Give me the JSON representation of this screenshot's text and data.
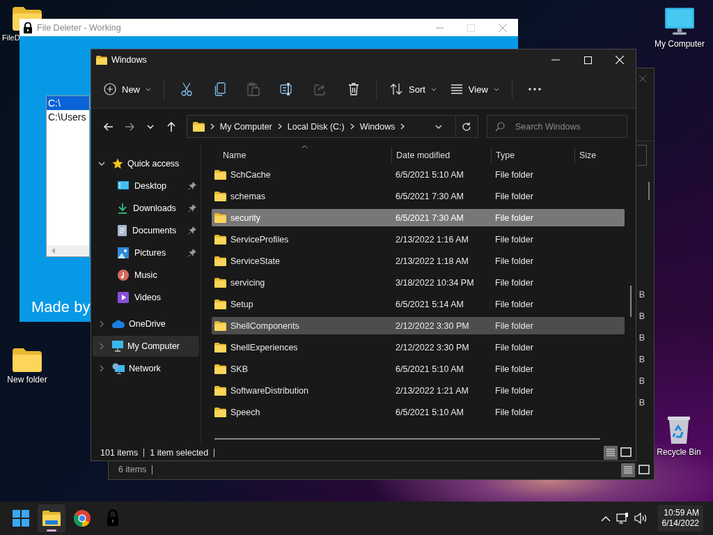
{
  "desktop_icons": [
    {
      "label": "FileD",
      "kind": "folder"
    },
    {
      "label": "New folder",
      "kind": "folder"
    },
    {
      "label": "My Computer",
      "kind": "computer"
    },
    {
      "label": "Recycle Bin",
      "kind": "recycle"
    }
  ],
  "file_deleter": {
    "title": "File Deleter - Working",
    "paths": [
      {
        "text": "C:\\",
        "selected": true
      },
      {
        "text": "C:\\Users",
        "selected": false
      }
    ],
    "footer": "Made by"
  },
  "back_explorer": {
    "sizes": [
      "B",
      "B",
      "B",
      "B",
      "B",
      "B"
    ],
    "status_bar": {
      "item_count": "6 items"
    }
  },
  "explorer": {
    "title": "Windows",
    "toolbar": [
      {
        "kind": "new",
        "label": "New",
        "disabled": false
      },
      {
        "kind": "cut",
        "disabled": false
      },
      {
        "kind": "copy",
        "disabled": false
      },
      {
        "kind": "paste",
        "disabled": true
      },
      {
        "kind": "rename",
        "disabled": false
      },
      {
        "kind": "share",
        "disabled": true
      },
      {
        "kind": "delete",
        "disabled": false
      },
      {
        "kind": "sort",
        "label": "Sort",
        "disabled": false
      },
      {
        "kind": "view",
        "label": "View",
        "disabled": false
      },
      {
        "kind": "more",
        "disabled": false
      }
    ],
    "nav": [
      {
        "kind": "back",
        "disabled": false
      },
      {
        "kind": "forward",
        "disabled": true
      },
      {
        "kind": "recent",
        "disabled": false
      },
      {
        "kind": "up",
        "disabled": false
      }
    ],
    "breadcrumb": [
      "My Computer",
      "Local Disk (C:)",
      "Windows"
    ],
    "search": {
      "placeholder": "Search Windows"
    },
    "sidebar": [
      {
        "label": "Quick access",
        "kind": "star",
        "expanded": true,
        "selected": false,
        "children": [
          {
            "label": "Desktop",
            "kind": "desktop",
            "pinned": true
          },
          {
            "label": "Downloads",
            "kind": "downloads",
            "pinned": true
          },
          {
            "label": "Documents",
            "kind": "documents",
            "pinned": true
          },
          {
            "label": "Pictures",
            "kind": "pictures",
            "pinned": true
          },
          {
            "label": "Music",
            "kind": "music",
            "pinned": false
          },
          {
            "label": "Videos",
            "kind": "videos",
            "pinned": false
          }
        ]
      },
      {
        "label": "OneDrive",
        "kind": "cloud",
        "expanded": false,
        "selected": false
      },
      {
        "label": "My Computer",
        "kind": "computer",
        "expanded": false,
        "selected": true
      },
      {
        "label": "Network",
        "kind": "network",
        "expanded": false,
        "selected": false
      }
    ],
    "columns": [
      {
        "label": "Name",
        "sorted": true
      },
      {
        "label": "Date modified",
        "sorted": false
      },
      {
        "label": "Type",
        "sorted": false
      },
      {
        "label": "Size",
        "sorted": false
      }
    ],
    "rows": [
      {
        "name": "SchCache",
        "date": "6/5/2021 5:10 AM",
        "type": "File folder",
        "selected": false,
        "hovered": false
      },
      {
        "name": "schemas",
        "date": "6/5/2021 7:30 AM",
        "type": "File folder",
        "selected": false,
        "hovered": false
      },
      {
        "name": "security",
        "date": "6/5/2021 7:30 AM",
        "type": "File folder",
        "selected": true,
        "hovered": false
      },
      {
        "name": "ServiceProfiles",
        "date": "2/13/2022 1:16 AM",
        "type": "File folder",
        "selected": false,
        "hovered": false
      },
      {
        "name": "ServiceState",
        "date": "2/13/2022 1:18 AM",
        "type": "File folder",
        "selected": false,
        "hovered": false
      },
      {
        "name": "servicing",
        "date": "3/18/2022 10:34 PM",
        "type": "File folder",
        "selected": false,
        "hovered": false
      },
      {
        "name": "Setup",
        "date": "6/5/2021 5:14 AM",
        "type": "File folder",
        "selected": false,
        "hovered": false
      },
      {
        "name": "ShellComponents",
        "date": "2/12/2022 3:30 PM",
        "type": "File folder",
        "selected": false,
        "hovered": true
      },
      {
        "name": "ShellExperiences",
        "date": "2/12/2022 3:30 PM",
        "type": "File folder",
        "selected": false,
        "hovered": false
      },
      {
        "name": "SKB",
        "date": "6/5/2021 5:10 AM",
        "type": "File folder",
        "selected": false,
        "hovered": false
      },
      {
        "name": "SoftwareDistribution",
        "date": "2/13/2022 1:21 AM",
        "type": "File folder",
        "selected": false,
        "hovered": false
      },
      {
        "name": "Speech",
        "date": "6/5/2021 5:10 AM",
        "type": "File folder",
        "selected": false,
        "hovered": false
      }
    ],
    "status_bar": {
      "item_count": "101 items",
      "selection": "1 item selected"
    }
  },
  "taskbar": {
    "apps": [
      {
        "kind": "start",
        "active": false
      },
      {
        "kind": "explorer",
        "active": true
      },
      {
        "kind": "chrome",
        "active": false
      },
      {
        "kind": "lock",
        "active": false
      }
    ],
    "clock": {
      "time": "10:59 AM",
      "date": "6/14/2022"
    }
  }
}
